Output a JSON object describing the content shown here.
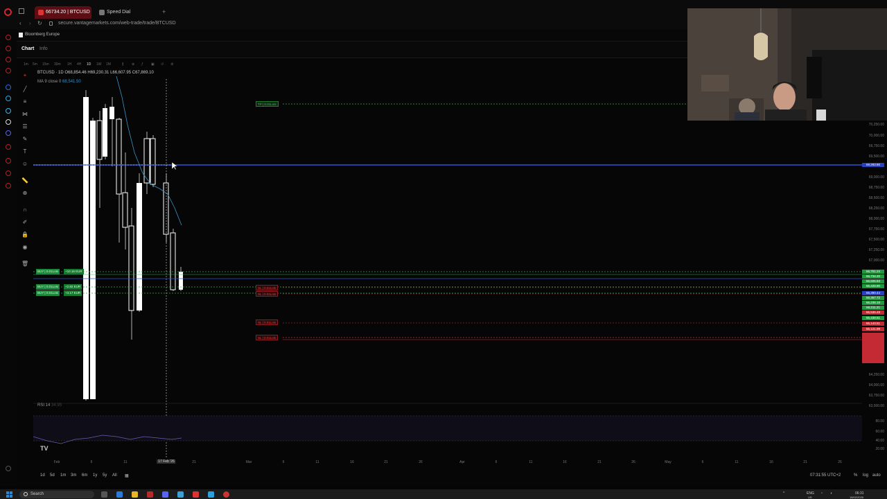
{
  "browser": {
    "tabs": [
      {
        "label": "66734.20 | BTCUSD | Va..."
      },
      {
        "label": "Speed Dial"
      }
    ],
    "new_tab": "+",
    "url": "secure.vantagemarkets.com/web-trade/trade/BTCUSD",
    "bookmark": "Bloomberg Europe"
  },
  "app": {
    "tabs": {
      "chart": "Chart",
      "info": "Info"
    }
  },
  "toolbar": {
    "timeframes": [
      "1m",
      "5m",
      "15m",
      "30m",
      "1H",
      "4H",
      "1D",
      "1W",
      "1M"
    ],
    "selected": "1D"
  },
  "chart_header": {
    "symbol": "BTCUSD · 1D",
    "ohlc": "O68,854.46  H69,230.31  L66,607.95  C67,869.10",
    "ma_label": "MA 9 close 0",
    "ma_value": "68,541.50",
    "rsi_label": "RSI 14",
    "rsi_value": "34.95"
  },
  "orders": {
    "tp": "TP | 0.01Lots",
    "sl_labels": [
      "SL | 0.01Lots",
      "SL | 0.01Lots",
      "SL | 0.01Lots",
      "SL | 0.01Lots"
    ],
    "buy_labels": [
      "BUY | 0.01Lots",
      "BUY | 0.01Lots",
      "BUY | 0.01Lots"
    ],
    "pnl": [
      "+10.16 EUR",
      "+2.82 EUR",
      "+4.17 EUR"
    ]
  },
  "price_axis": {
    "ticks": [
      "70,250.00",
      "70,000.00",
      "69,750.00",
      "69,500.00",
      "69,000.00",
      "68,750.00",
      "68,500.00",
      "68,250.00",
      "68,000.00",
      "67,750.00",
      "67,500.00",
      "67,250.00",
      "67,000.00",
      "64,250.00",
      "64,000.00",
      "63,750.00",
      "63,500.00"
    ],
    "cursor_price": "69,293.80",
    "tags": [
      "66,751.24",
      "66,734.20",
      "66,605.83",
      "66,428.80",
      "66,390.44",
      "66,367.72",
      "66,238.18",
      "66,211.21",
      "65,536.49",
      "65,438.61",
      "65,143.51",
      "65,121.99"
    ],
    "rsi_ticks": [
      "80.00",
      "60.00",
      "40.00",
      "20.00"
    ]
  },
  "time_axis": {
    "ticks": [
      "Feb",
      "6",
      "11",
      "21",
      "Mar",
      "6",
      "11",
      "16",
      "21",
      "26",
      "Apr",
      "6",
      "11",
      "16",
      "21",
      "26",
      "May",
      "6",
      "11",
      "16",
      "21",
      "26"
    ],
    "crosshair": "17 Feb '26"
  },
  "bottom_bar": {
    "ranges": [
      "1d",
      "5d",
      "1m",
      "3m",
      "6m",
      "1y",
      "5y",
      "All"
    ],
    "clock": "07:31:55 UTC+2",
    "options": [
      "%",
      "log",
      "auto"
    ]
  },
  "taskbar": {
    "search": "Search",
    "lang": "ENG",
    "region": "US",
    "time": "06:31",
    "date": "18/02/2026"
  },
  "colors": {
    "up_candle": "#ffffff",
    "tp_line": "#2fb34a",
    "sl_line": "#d8333b",
    "cursor_line": "#3350d6",
    "ma_line": "#3a93c4",
    "brand": "#e0202c"
  }
}
